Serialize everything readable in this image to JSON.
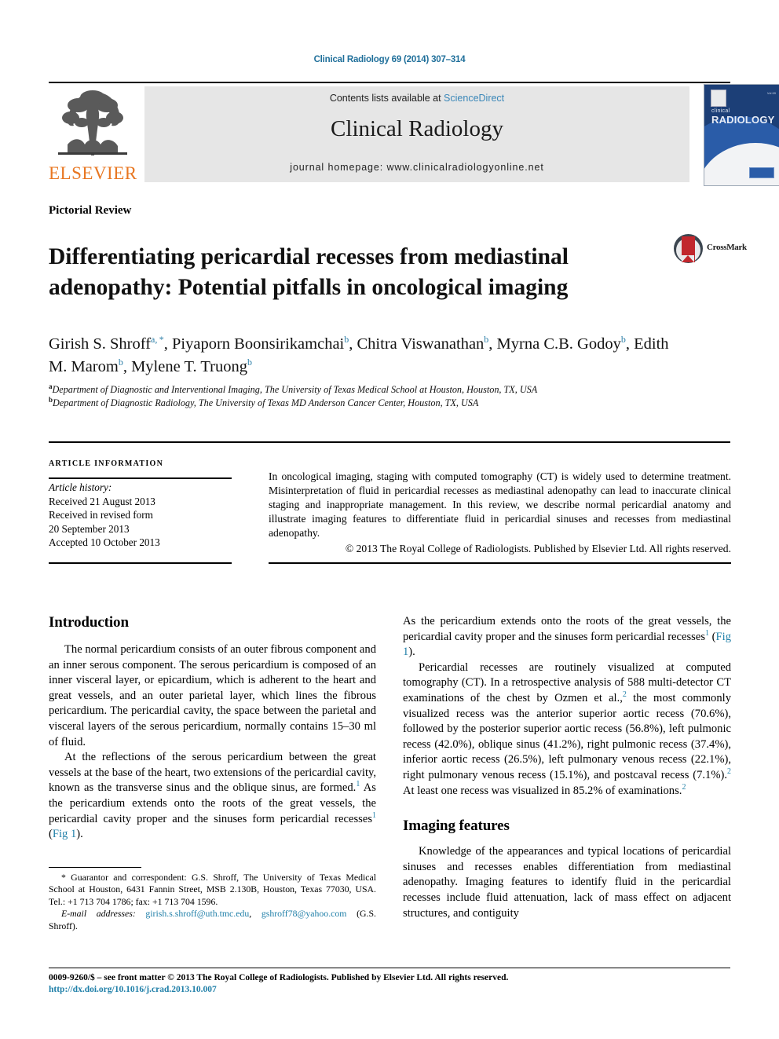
{
  "running_head": "Clinical Radiology 69 (2014) 307–314",
  "masthead": {
    "publisher_logo_label": "ELSEVIER",
    "contents_prefix": "Contents lists available at ",
    "contents_link": "ScienceDirect",
    "journal_title": "Clinical Radiology",
    "homepage": "journal homepage: www.clinicalradiologyonline.net",
    "cover": {
      "line1": "clinical",
      "line2": "RADIOLOGY"
    }
  },
  "article": {
    "type": "Pictorial Review",
    "title": "Differentiating pericardial recesses from mediastinal adenopathy: Potential pitfalls in oncological imaging",
    "crossmark_label": "CrossMark",
    "authors_line1": "Girish S. Shroff",
    "authors_html": "Girish S. Shroff<sup>a, *</sup>, Piyaporn Boonsirikamchai<sup>b</sup>, Chitra Viswanathan<sup>b</sup>, Myrna C.B. Godoy<sup>b</sup>, Edith M. Marom<sup>b</sup>, Mylene T. Truong<sup>b</sup>",
    "affiliations": [
      {
        "marker": "a",
        "text": "Department of Diagnostic and Interventional Imaging, The University of Texas Medical School at Houston, Houston, TX, USA"
      },
      {
        "marker": "b",
        "text": "Department of Diagnostic Radiology, The University of Texas MD Anderson Cancer Center, Houston, TX, USA"
      }
    ]
  },
  "info": {
    "heading": "ARTICLE INFORMATION",
    "history_label": "Article history:",
    "history": [
      "Received 21 August 2013",
      "Received in revised form",
      "20 September 2013",
      "Accepted 10 October 2013"
    ]
  },
  "abstract": {
    "text": "In oncological imaging, staging with computed tomography (CT) is widely used to determine treatment. Misinterpretation of fluid in pericardial recesses as mediastinal adenopathy can lead to inaccurate clinical staging and inappropriate management. In this review, we describe normal pericardial anatomy and illustrate imaging features to differentiate fluid in pericardial sinuses and recesses from mediastinal adenopathy.",
    "copyright": "© 2013 The Royal College of Radiologists. Published by Elsevier Ltd. All rights reserved."
  },
  "sections": {
    "introduction_heading": "Introduction",
    "intro_p1": "The normal pericardium consists of an outer fibrous component and an inner serous component. The serous pericardium is composed of an inner visceral layer, or epicardium, which is adherent to the heart and great vessels, and an outer parietal layer, which lines the fibrous pericardium. The pericardial cavity, the space between the parietal and visceral layers of the serous pericardium, normally contains 15–30 ml of fluid.",
    "intro_p2_a": "At the reflections of the serous pericardium between the great vessels at the base of the heart, two extensions of the pericardial cavity, known as the transverse sinus and the oblique sinus, are formed.",
    "intro_p2_ref1": "1",
    "intro_p2_b": " As the pericardium extends onto the roots of the great vessels, the pericardial cavity proper and the sinuses form pericardial recesses",
    "intro_p2_ref2": "1",
    "intro_p2_c": " (",
    "intro_p2_figlink": "Fig 1",
    "intro_p2_d": ").",
    "intro_p3_a": "Pericardial recesses are routinely visualized at computed tomography (CT). In a retrospective analysis of 588 multi-detector CT examinations of the chest by Ozmen et al.,",
    "intro_p3_ref1": "2",
    "intro_p3_b": " the most commonly visualized recess was the anterior superior aortic recess (70.6%), followed by the posterior superior aortic recess (56.8%), left pulmonic recess (42.0%), oblique sinus (41.2%), right pulmonic recess (37.4%), inferior aortic recess (26.5%), left pulmonary venous recess (22.1%), right pulmonary venous recess (15.1%), and postcaval recess (7.1%).",
    "intro_p3_ref2": "2",
    "intro_p3_c": " At least one recess was visualized in 85.2% of examinations.",
    "intro_p3_ref3": "2",
    "imaging_heading": "Imaging features",
    "imaging_p1": "Knowledge of the appearances and typical locations of pericardial sinuses and recesses enables differentiation from mediastinal adenopathy. Imaging features to identify fluid in the pericardial recesses include fluid attenuation, lack of mass effect on adjacent structures, and contiguity"
  },
  "footnotes": {
    "correspondence": "* Guarantor and correspondent: G.S. Shroff, The University of Texas Medical School at Houston, 6431 Fannin Street, MSB 2.130B, Houston, Texas 77030, USA. Tel.: +1 713 704 1786; fax: +1 713 704 1596.",
    "email_label": "E-mail addresses:",
    "email1": "girish.s.shroff@uth.tmc.edu",
    "email2": "gshroff78@yahoo.com",
    "email_suffix": "(G.S. Shroff)."
  },
  "bottom": {
    "issn_line": "0009-9260/$ – see front matter © 2013 The Royal College of Radiologists. Published by Elsevier Ltd. All rights reserved.",
    "doi": "http://dx.doi.org/10.1016/j.crad.2013.10.007"
  },
  "colors": {
    "link": "#1f7fa8",
    "runhead": "#1f6f9a",
    "elsevier_orange": "#e87722",
    "banner_bg": "#e6e6e6",
    "crossmark_red": "#c1272d",
    "cover_blue": "#1c3f77"
  }
}
